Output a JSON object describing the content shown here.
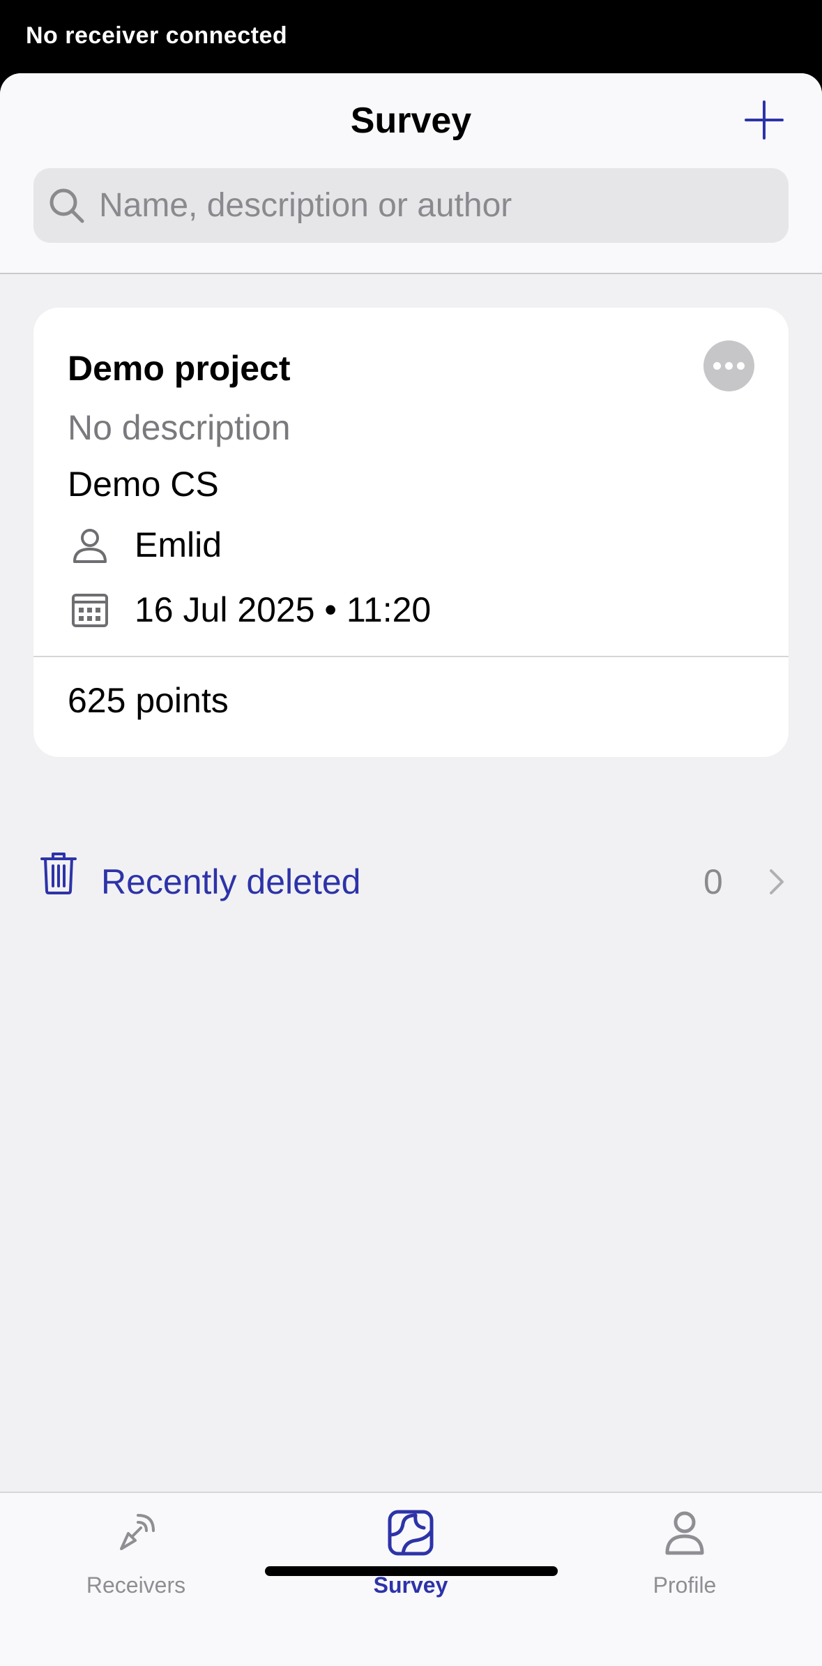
{
  "status": {
    "text": "No receiver connected"
  },
  "header": {
    "title": "Survey",
    "search_placeholder": "Name, description or author"
  },
  "project": {
    "name": "Demo project",
    "description": "No description",
    "coordinate_system": "Demo CS",
    "author": "Emlid",
    "date": "16 Jul 2025 • 11:20",
    "points": "625 points"
  },
  "recently_deleted": {
    "label": "Recently deleted",
    "count": "0"
  },
  "tabs": [
    {
      "label": "Receivers",
      "icon": "receiver-icon",
      "active": false
    },
    {
      "label": "Survey",
      "icon": "survey-map-icon",
      "active": true
    },
    {
      "label": "Profile",
      "icon": "profile-icon",
      "active": false
    }
  ],
  "colors": {
    "accent": "#2d33a8",
    "muted": "#8e8e93",
    "background": "#f1f1f3"
  }
}
